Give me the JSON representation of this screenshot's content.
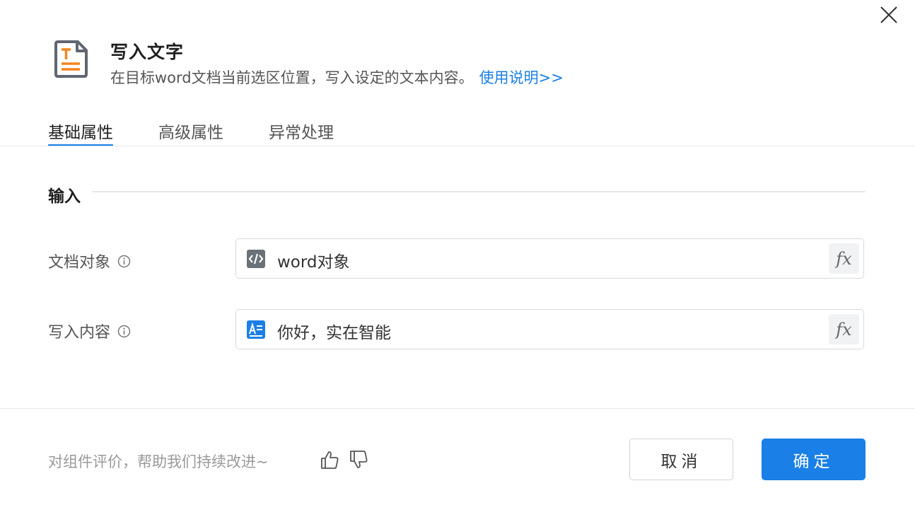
{
  "dialog": {
    "title": "写入文字",
    "description": "在目标word文档当前选区位置，写入设定的文本内容。",
    "help_link": "使用说明>>"
  },
  "tabs": [
    {
      "label": "基础属性",
      "active": true
    },
    {
      "label": "高级属性",
      "active": false
    },
    {
      "label": "异常处理",
      "active": false
    }
  ],
  "section": {
    "title": "输入"
  },
  "fields": [
    {
      "label": "文档对象",
      "value": "word对象",
      "icon": "code-variable-icon",
      "fx": "fx"
    },
    {
      "label": "写入内容",
      "value": "你好，实在智能",
      "icon": "text-content-icon",
      "fx": "fx"
    }
  ],
  "footer": {
    "feedback_text": "对组件评价，帮助我们持续改进~",
    "cancel_label": "取消",
    "ok_label": "确定"
  },
  "colors": {
    "accent": "#1a7fe6",
    "icon_orange": "#f5841f",
    "icon_gray": "#5f6670"
  }
}
